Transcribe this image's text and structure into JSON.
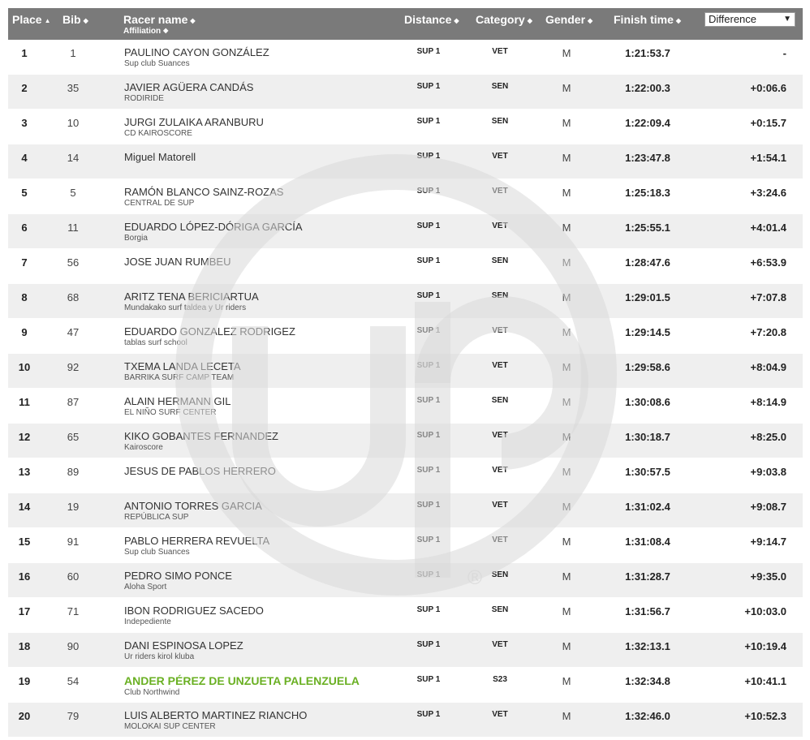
{
  "header": {
    "place": "Place",
    "bib": "Bib",
    "racer_name": "Racer name",
    "affiliation": "Affiliation",
    "distance": "Distance",
    "category": "Category",
    "gender": "Gender",
    "finish_time": "Finish time",
    "difference_select": "Difference",
    "sort_asc_glyph": "▲",
    "sort_both_glyph": "◆",
    "select_arrow": "▼"
  },
  "watermark": {
    "icon": "up-logo-watermark",
    "registered": "®"
  },
  "rows": [
    {
      "place": "1",
      "bib": "1",
      "name": "PAULINO CAYON GONZÁLEZ",
      "affiliation": "Sup club Suances",
      "distance": "SUP 1",
      "category": "VET",
      "gender": "M",
      "time": "1:21:53.7",
      "diff": "-"
    },
    {
      "place": "2",
      "bib": "35",
      "name": "JAVIER AGÜERA CANDÁS",
      "affiliation": "RODIRIDE",
      "distance": "SUP 1",
      "category": "SEN",
      "gender": "M",
      "time": "1:22:00.3",
      "diff": "+0:06.6"
    },
    {
      "place": "3",
      "bib": "10",
      "name": "JURGI ZULAIKA ARANBURU",
      "affiliation": "CD KAIROSCORE",
      "distance": "SUP 1",
      "category": "SEN",
      "gender": "M",
      "time": "1:22:09.4",
      "diff": "+0:15.7"
    },
    {
      "place": "4",
      "bib": "14",
      "name": "Miguel Matorell",
      "affiliation": "",
      "distance": "SUP 1",
      "category": "VET",
      "gender": "M",
      "time": "1:23:47.8",
      "diff": "+1:54.1"
    },
    {
      "place": "5",
      "bib": "5",
      "name": "RAMÓN BLANCO SAINZ-ROZAS",
      "affiliation": "CENTRAL DE SUP",
      "distance": "SUP 1",
      "category": "VET",
      "gender": "M",
      "time": "1:25:18.3",
      "diff": "+3:24.6"
    },
    {
      "place": "6",
      "bib": "11",
      "name": "EDUARDO LÓPEZ-DÓRIGA GARCÍA",
      "affiliation": "Borgia",
      "distance": "SUP 1",
      "category": "VET",
      "gender": "M",
      "time": "1:25:55.1",
      "diff": "+4:01.4"
    },
    {
      "place": "7",
      "bib": "56",
      "name": "JOSE JUAN RUMBEU",
      "affiliation": "",
      "distance": "SUP 1",
      "category": "SEN",
      "gender": "M",
      "time": "1:28:47.6",
      "diff": "+6:53.9"
    },
    {
      "place": "8",
      "bib": "68",
      "name": "ARITZ TENA BERICIARTUA",
      "affiliation": "Mundakako surf taldea y Ur riders",
      "distance": "SUP 1",
      "category": "SEN",
      "gender": "M",
      "time": "1:29:01.5",
      "diff": "+7:07.8"
    },
    {
      "place": "9",
      "bib": "47",
      "name": "EDUARDO GONZALEZ RODRIGEZ",
      "affiliation": "tablas surf school",
      "distance": "SUP 1",
      "category": "VET",
      "gender": "M",
      "time": "1:29:14.5",
      "diff": "+7:20.8"
    },
    {
      "place": "10",
      "bib": "92",
      "name": "TXEMA LANDA LECETA",
      "affiliation": "BARRIKA SURF CAMP TEAM",
      "distance": "SUP 1",
      "category": "VET",
      "gender": "M",
      "time": "1:29:58.6",
      "diff": "+8:04.9"
    },
    {
      "place": "11",
      "bib": "87",
      "name": "ALAIN HERMANN GIL",
      "affiliation": "EL NIÑO SURF CENTER",
      "distance": "SUP 1",
      "category": "SEN",
      "gender": "M",
      "time": "1:30:08.6",
      "diff": "+8:14.9"
    },
    {
      "place": "12",
      "bib": "65",
      "name": "KIKO GOBANTES FERNANDEZ",
      "affiliation": "Kairoscore",
      "distance": "SUP 1",
      "category": "VET",
      "gender": "M",
      "time": "1:30:18.7",
      "diff": "+8:25.0"
    },
    {
      "place": "13",
      "bib": "89",
      "name": "JESUS DE PABLOS HERRERO",
      "affiliation": "",
      "distance": "SUP 1",
      "category": "VET",
      "gender": "M",
      "time": "1:30:57.5",
      "diff": "+9:03.8"
    },
    {
      "place": "14",
      "bib": "19",
      "name": "ANTONIO TORRES GARCIA",
      "affiliation": "REPÚBLICA SUP",
      "distance": "SUP 1",
      "category": "VET",
      "gender": "M",
      "time": "1:31:02.4",
      "diff": "+9:08.7"
    },
    {
      "place": "15",
      "bib": "91",
      "name": "PABLO HERRERA REVUELTA",
      "affiliation": "Sup club Suances",
      "distance": "SUP 1",
      "category": "VET",
      "gender": "M",
      "time": "1:31:08.4",
      "diff": "+9:14.7"
    },
    {
      "place": "16",
      "bib": "60",
      "name": "PEDRO SIMO PONCE",
      "affiliation": "Aloha Sport",
      "distance": "SUP 1",
      "category": "SEN",
      "gender": "M",
      "time": "1:31:28.7",
      "diff": "+9:35.0"
    },
    {
      "place": "17",
      "bib": "71",
      "name": "IBON RODRIGUEZ SACEDO",
      "affiliation": "Indepediente",
      "distance": "SUP 1",
      "category": "SEN",
      "gender": "M",
      "time": "1:31:56.7",
      "diff": "+10:03.0"
    },
    {
      "place": "18",
      "bib": "90",
      "name": "DANI ESPINOSA LOPEZ",
      "affiliation": "Ur riders kirol kluba",
      "distance": "SUP 1",
      "category": "VET",
      "gender": "M",
      "time": "1:32:13.1",
      "diff": "+10:19.4"
    },
    {
      "place": "19",
      "bib": "54",
      "name": "ANDER PÉREZ DE UNZUETA PALENZUELA",
      "affiliation": "Club Northwind",
      "distance": "SUP 1",
      "category": "S23",
      "gender": "M",
      "time": "1:32:34.8",
      "diff": "+10:41.1",
      "highlight": true
    },
    {
      "place": "20",
      "bib": "79",
      "name": "LUIS ALBERTO MARTINEZ RIANCHO",
      "affiliation": "MOLOKAI SUP CENTER",
      "distance": "SUP 1",
      "category": "VET",
      "gender": "M",
      "time": "1:32:46.0",
      "diff": "+10:52.3"
    }
  ],
  "colors": {
    "header_bg": "#7a7a7a",
    "row_alt_bg": "#efefef",
    "highlight_name": "#6ab023",
    "watermark": "#d6d6d6"
  }
}
